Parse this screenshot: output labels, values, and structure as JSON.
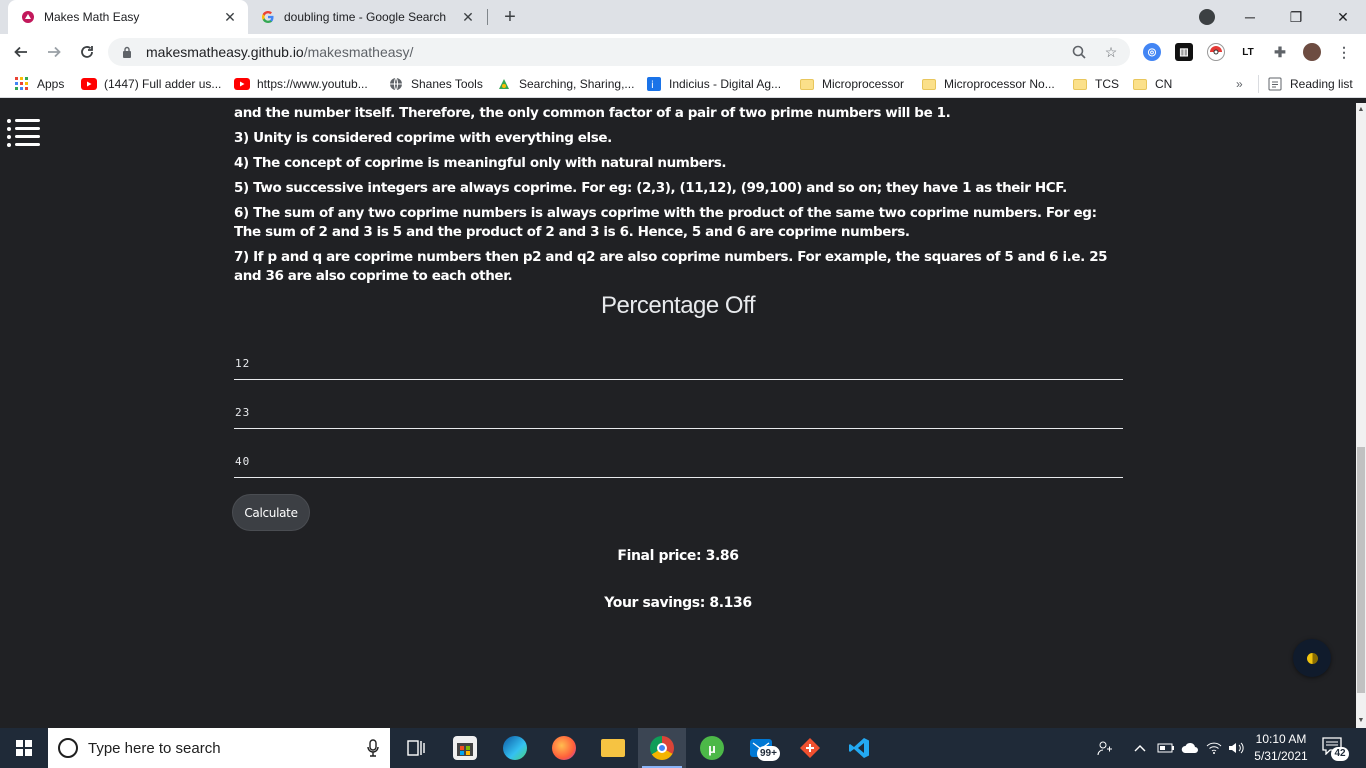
{
  "browser": {
    "tabs": [
      {
        "title": "Makes Math Easy",
        "active": true
      },
      {
        "title": "doubling time - Google Search",
        "active": false
      }
    ],
    "new_tab_label": "+",
    "window_controls": {
      "minimize": "─",
      "restore": "❐",
      "close": "✕"
    },
    "url_host": "makesmatheasy.github.io",
    "url_path": "/makesmatheasy/",
    "bookmarks": [
      {
        "label": "Apps",
        "icon": "apps-grid-icon"
      },
      {
        "label": "(1447) Full adder us...",
        "icon": "youtube-icon"
      },
      {
        "label": "https://www.youtub...",
        "icon": "youtube-icon"
      },
      {
        "label": "Shanes Tools",
        "icon": "globe-icon"
      },
      {
        "label": "Searching, Sharing,...",
        "icon": "site-icon"
      },
      {
        "label": "Indicius - Digital Ag...",
        "icon": "indicius-icon"
      },
      {
        "label": "Microprocessor",
        "icon": "folder-icon"
      },
      {
        "label": "Microprocessor No...",
        "icon": "folder-icon"
      },
      {
        "label": "TCS",
        "icon": "folder-icon"
      },
      {
        "label": "CN",
        "icon": "folder-icon"
      }
    ],
    "bookmarks_overflow": "»",
    "reading_list": "Reading list"
  },
  "page": {
    "article_lines": [
      "and the number itself. Therefore, the only common factor of a pair of two prime numbers will be 1.",
      "3) Unity is considered coprime with everything else.",
      "4) The concept of coprime is meaningful only with natural numbers.",
      "5) Two successive integers are always coprime. For eg: (2,3), (11,12), (99,100) and so on; they have 1 as their HCF.",
      "6) The sum of any two coprime numbers is always coprime with the product of the same two coprime numbers. For eg: The sum of 2 and 3 is 5 and the product of 2 and 3 is 6. Hence, 5 and 6 are coprime numbers.",
      "7) If p and q are coprime numbers then p2 and q2 are also coprime numbers. For example, the squares of 5 and 6 i.e. 25 and 36 are also coprime to each other."
    ],
    "section_title": "Percentage Off",
    "inputs": {
      "first": "12",
      "second": "23",
      "third": "40"
    },
    "calculate_label": "Calculate",
    "final_price": "Final price: 3.86",
    "savings": "Your savings: 8.136"
  },
  "taskbar": {
    "search_placeholder": "Type here to search",
    "mail_badge": "99+",
    "time": "10:10 AM",
    "date": "5/31/2021",
    "notification_count": "42"
  },
  "colors": {
    "page_bg": "#202124",
    "taskbar_bg": "#1f2a38",
    "tab_strip_bg": "#dee1e6",
    "text_on_dark": "#ffffff"
  }
}
